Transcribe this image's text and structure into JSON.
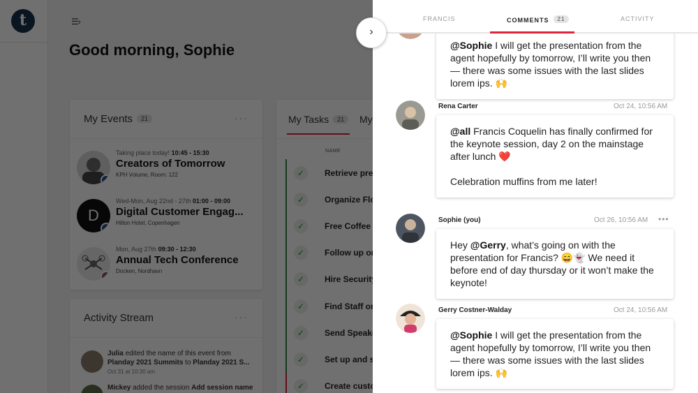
{
  "app": {
    "logo_letter": "t",
    "menu_icon": "☰›",
    "greeting": "Good morning, Sophie"
  },
  "events_card": {
    "title": "My Events",
    "count": "21",
    "more": "···",
    "items": [
      {
        "meta_prefix": "Taking place today!",
        "meta_time": "10:45 - 15:30",
        "name": "Creators of Tomorrow",
        "location": "KPH Volume, Room: 122",
        "avatar_letter": ""
      },
      {
        "meta_prefix": "Wed-Mon, Aug 22nd - 27th",
        "meta_time": "01:00 - 09:00",
        "name": "Digital Customer Engag...",
        "location": "Hilton Hotel, Copenhagen",
        "avatar_letter": "D"
      },
      {
        "meta_prefix": "Mon, Aug 27th",
        "meta_time": "09:30 - 12:30",
        "name": "Annual Tech Conference",
        "location": "Docken, Nordhavn",
        "avatar_letter": ""
      }
    ]
  },
  "activity_card": {
    "title": "Activity Stream",
    "more": "···",
    "items": [
      {
        "user": "Julia",
        "text_a": " edited the name of this event from ",
        "from": "Planday 2021 Summits",
        "text_b": " to ",
        "to": "Planday 2021 S...",
        "time": "Oct 31 at 10:30 am"
      },
      {
        "user": "Mickey",
        "text_a": " added the session ",
        "from": "Add session name",
        "text_b": "",
        "to": "",
        "time": ""
      }
    ]
  },
  "tasks_card": {
    "tab_tasks": "My Tasks",
    "tab_tasks_count": "21",
    "tab_next": "My",
    "col_name": "NAME",
    "check_icon": "✓",
    "tasks": [
      "Retrieve pre",
      "Organize Flo",
      "Free Coffee a",
      "Follow up on",
      "Hire Security",
      "Find Staff on",
      "Send Speake",
      "Set up and sh",
      "Create custo"
    ]
  },
  "panel": {
    "collapse_icon": "›",
    "tabs": [
      {
        "label": "FRANCIS"
      },
      {
        "label": "COMMENTS",
        "count": "21"
      },
      {
        "label": "ACTIVITY"
      }
    ],
    "comments": [
      {
        "author": "",
        "time": "",
        "mention": "@Sophie",
        "body": " I will get the presentation from the agent hopefully by tomorrow, I’ll write you then — there was some issues with the last slides lorem ips. 🙌"
      },
      {
        "author": "Rena Carter",
        "time": "Oct 24, 10:56 AM",
        "mention": "@all",
        "body": " Francis Coquelin has finally confirmed for the keynote session, day 2 on the mainstage after lunch ❤️",
        "body2": "Celebration muffins from me later!"
      },
      {
        "author": "Sophie (you)",
        "time": "Oct 26, 10:56 AM",
        "more": "•••",
        "pre": "Hey ",
        "mention": "@Gerry",
        "body": ", what’s going on with the presentation for Francis? 😄👻 We need it before end of day thursday or it won’t make the keynote!"
      },
      {
        "author": "Gerry Costner-Walday",
        "time": "Oct 24, 10:56 AM",
        "mention": "@Sophie",
        "body": " I will get the presentation from the agent hopefully by tomorrow, I’ll write you then — there was some issues with the last slides lorem ips. 🙌"
      }
    ]
  }
}
